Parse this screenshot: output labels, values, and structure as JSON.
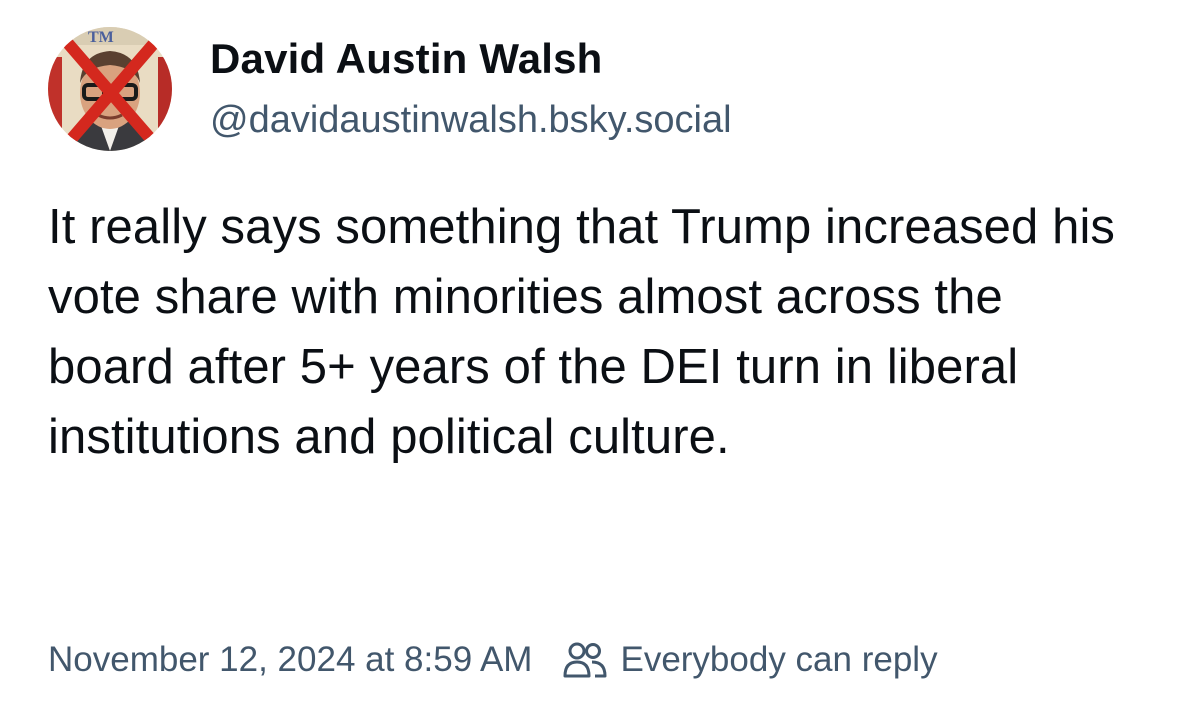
{
  "post": {
    "author": {
      "display_name": "David Austin Walsh",
      "handle": "@davidaustinwalsh.bsky.social",
      "avatar_icon": "portrait-with-red-x-avatar"
    },
    "text": "It really says something that Trump increased his vote share with minorities almost across the board after 5+ years of the DEI turn in liberal institutions and political culture.",
    "timestamp": "November 12, 2024 at 8:59 AM",
    "reply_setting": {
      "icon": "people-icon",
      "label": "Everybody can reply"
    }
  },
  "colors": {
    "text_primary": "#0b0f14",
    "text_secondary": "#42576c",
    "background": "#ffffff",
    "avatar_x": "#d4281e"
  }
}
